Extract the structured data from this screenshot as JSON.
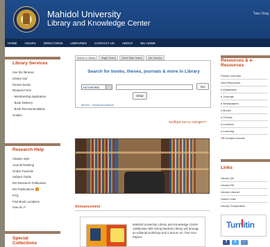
{
  "header": {
    "title": "Mahidol University",
    "subtitle": "Library and Knowledge Center",
    "language_label": "ไทย / Eng"
  },
  "nav": {
    "items": [
      "HOME",
      "HOURS",
      "DIRECTIONS",
      "LIBRARIES",
      "CONTACT US",
      "ABOUT",
      "MU HOME"
    ]
  },
  "left_sidebar": {
    "library_services": {
      "title": "Library Services",
      "items": [
        "Use the libraries",
        "Library tour",
        "Renew books",
        "Request Form",
        "- Membership Application",
        "- Book Delivery",
        "- Book Recommendation",
        "Guides"
      ]
    },
    "research_help": {
      "title": "Research Help",
      "items": [
        "Citation style",
        "Journal Ranking",
        "Online Tutorials",
        "Subject Guide",
        "MU Research Publication",
        "MU Publications",
        "FAQ",
        "Find Book Locations",
        "How do I?"
      ]
    },
    "special_collections": {
      "title": "Special Collections"
    }
  },
  "search": {
    "tabs": [
      "Search in Library",
      "Single Search",
      "World Wide Search",
      "Ask Librarian"
    ],
    "title": "Search for books, theses, journals & more in Library",
    "select_value": "KEYWORD",
    "go_label": "Go",
    "clear_label": "Clear",
    "advanced_text": "MUSIC : Advanced search"
  },
  "center": {
    "thai_notice": "ขอเชิญชวนอ่าน \"หลักสูตรฯ\"",
    "announcement_title": "Announcement",
    "announcement_text": "Mahidol University Library and Knowledge Center collaborate with Siriraj Medical Library will arrange an editorial workshop and a lecture on \"Get Your Papers"
  },
  "right_sidebar": {
    "resources": {
      "title": "Resources & e-Resources",
      "items": [
        "Printed Journals",
        "New Resources",
        "e-Databases",
        "e-Journals",
        "e-Newspapers",
        "e-Books",
        "e-Theses",
        "e-Lectures",
        "e-Learning",
        "Off Campus Access"
      ]
    },
    "links": {
      "title": "Links",
      "items": [
        "Library QA",
        "Library KM",
        "Library Intranet",
        "Useful Links",
        "Library Cooperation"
      ]
    },
    "turnitin_label": "Turnitin"
  },
  "colors": {
    "header_blue": "#1f4c8c",
    "accent_orange": "#c64211",
    "background": "#8a8475"
  }
}
